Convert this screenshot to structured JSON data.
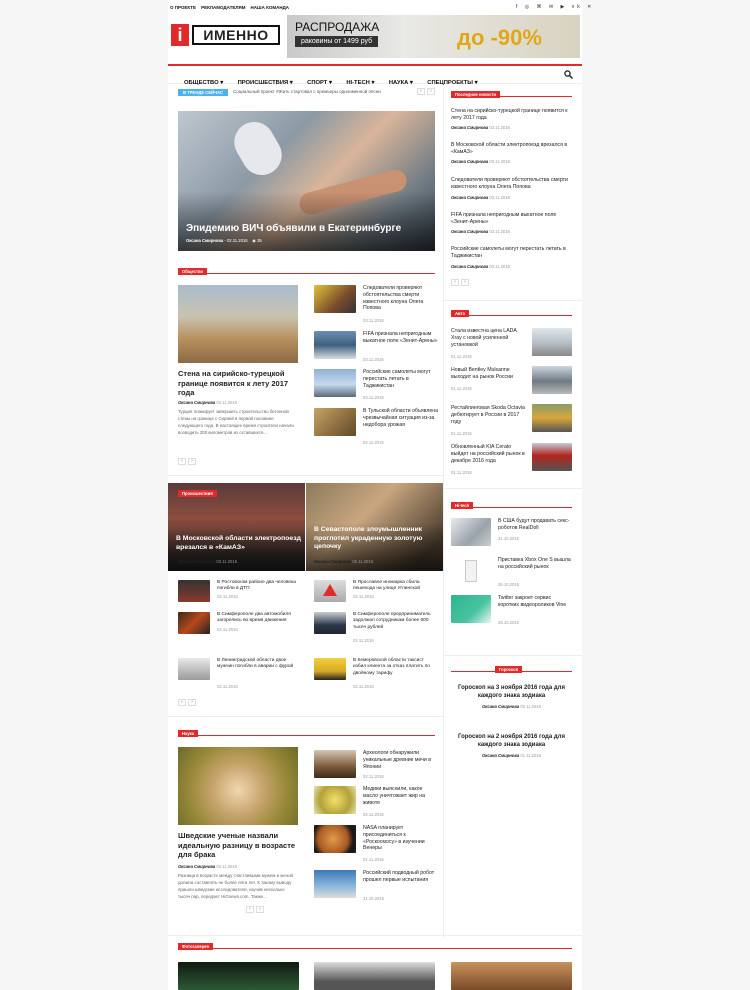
{
  "topbar": {
    "links": [
      "О ПРОЕКТЕ",
      "РЕКЛАМОДАТЕЛЯМ",
      "НАША КОМАНДА"
    ],
    "social": [
      "f",
      "◎",
      "⌘",
      "✉",
      "▶",
      "vk",
      "✕"
    ]
  },
  "logo": {
    "mark": "i",
    "name": "ИМЕННО"
  },
  "banner": {
    "title": "РАСПРОДАЖА",
    "sub": "раковины от 1499 руб",
    "discount": "до -90%"
  },
  "nav": {
    "items": [
      "ОБЩЕСТВО ▾",
      "ПРОИСШЕСТВИЯ ▾",
      "СПОРТ ▾",
      "HI-TECH ▾",
      "НАУКА ▾",
      "СПЕЦПРОЕКТЫ ▾"
    ]
  },
  "trend": {
    "label": "В ТРЕНДЕ СЕЙЧАС",
    "text": "Социальный проект #Жить стартовал с премьеры одноименной песни"
  },
  "hero": {
    "title": "Эпидемию ВИЧ объявили в Екатеринбурге",
    "author": "Оксана Смирнова",
    "date": "02.11.2016",
    "views": "35"
  },
  "society": {
    "badge": "Общество",
    "main": {
      "title": "Стена на сирийско-турецкой границе появится к лету 2017 года",
      "author": "Оксана Смирнова",
      "date": "03.11.2016",
      "excerpt": "Турция планирует завершить строительство бетонной стены на границе с Сирией в первой половине следующего года. В настоящее время строители начали возводить 200 километров из оставшихся..."
    },
    "list": [
      {
        "title": "Следователи проверяют обстоятельства смерти известного клоуна Олега Попова",
        "date": "03.11.2016"
      },
      {
        "title": "FIFA признала непригодным выкатное поле «Зенит-Арены»",
        "date": "03.11.2016"
      },
      {
        "title": "Российские самолеты могут перестать летать в Таджикистан",
        "date": "03.11.2016"
      },
      {
        "title": "В Тульской области объявлена чрезвычайная ситуация из-за недобора урожая",
        "date": "02.11.2016"
      }
    ]
  },
  "incidents": {
    "badge": "Происшествия",
    "big": [
      {
        "title": "В Московской области электропоезд врезался в «КамАЗ»",
        "author": "Оксана Смирнова",
        "date": "03.11.2016"
      },
      {
        "title": "В Севастополе злоумышленник проглотил украденную золотую цепочку",
        "author": "Оксана Смирнова",
        "date": "02.11.2016"
      }
    ],
    "list": [
      {
        "title": "В Ростовском районе два человека погибли в ДТП",
        "date": "02.11.2016"
      },
      {
        "title": "В Ярославле иномарка сбила пешехода на улице Углинской",
        "date": "02.11.2016"
      },
      {
        "title": "В Симферополе два автомобиля загорелись во время движения",
        "date": "02.11.2016"
      },
      {
        "title": "В Симферополе предприниматель задолжал сотрудникам более 600 тысяч рублей",
        "date": "02.11.2016"
      },
      {
        "title": "В Ленинградской области двое мужчин погибли в аварии с фурой",
        "date": "02.11.2016"
      },
      {
        "title": "В Кемеровской области таксист избил клиента за отказ платить по двойному тарифу",
        "date": "02.11.2016"
      }
    ]
  },
  "science": {
    "badge": "Наука",
    "main": {
      "title": "Шведские ученые назвали идеальную разницу в возрасте для брака",
      "author": "Оксана Смирнова",
      "date": "03.11.2016",
      "excerpt": "Разница в возрасте между счастливыми мужем и женой должна составлять не более пяти лет. К такому выводу пришли шведские исследователи, изучив несколько тысяч пар, передает HiGnews.com. Также..."
    },
    "list": [
      {
        "title": "Археологи обнаружили уникальные древние мечи в Японии",
        "date": "02.11.2016"
      },
      {
        "title": "Медики выяснили, какое масло уничтожает жир на животе",
        "date": "02.11.2016"
      },
      {
        "title": "NASA планирует присоединиться к «Роскосмосу» в изучении Венеры",
        "date": "01.11.2016"
      },
      {
        "title": "Российский подводный робот прошел первые испытания",
        "date": "31.10.2016"
      }
    ]
  },
  "photo": {
    "badge": "Фотогалерея"
  },
  "latest": {
    "badge": "Последние новости",
    "items": [
      {
        "title": "Стена на сирийско-турецкой границе появится к лету 2017 года",
        "author": "Оксана Смирнова",
        "date": "03.11.2016"
      },
      {
        "title": "В Московской области электропоезд врезался в «КамАЗ»",
        "author": "Оксана Смирнова",
        "date": "03.11.2016"
      },
      {
        "title": "Следователи проверяют обстоятельства смерти известного клоуна Олега Попова",
        "author": "Оксана Смирнова",
        "date": "03.11.2016"
      },
      {
        "title": "FIFA признала непригодным выкатное поле «Зенит-Арены»",
        "author": "Оксана Смирнова",
        "date": "03.11.2016"
      },
      {
        "title": "Российские самолеты могут перестать летать в Таджикистан",
        "author": "Оксана Смирнова",
        "date": "03.11.2016"
      }
    ]
  },
  "auto": {
    "badge": "Авто",
    "items": [
      {
        "title": "Стала известна цена LADA Xray с новой усиленной установкой",
        "date": "01.11.2016"
      },
      {
        "title": "Новый Bentley Mulsanne выходит на рынок России",
        "date": "01.11.2016"
      },
      {
        "title": "Рестайлинговая Skoda Octavia дебютирует в России в 2017 году",
        "date": "01.11.2016"
      },
      {
        "title": "Обновленный KIA Cerato выйдет на российский рынок в декабре 2016 года",
        "date": "01.11.2016"
      }
    ]
  },
  "hitech": {
    "badge": "Hi-tech",
    "items": [
      {
        "title": "В США будут продавать секс-роботов RealDoll",
        "date": "31.10.2016"
      },
      {
        "title": "Приставка Xbox One S вышла на российский рынок",
        "date": "28.10.2016"
      },
      {
        "title": "Twitter закроет сервис коротких видеороликов Vine",
        "date": "28.10.2016"
      }
    ]
  },
  "horo": {
    "badge": "Гороскоп",
    "items": [
      {
        "title": "Гороскоп на 3 ноября 2016 года для каждого знака зодиака",
        "author": "Оксана Смирнова",
        "date": "03.11.2016"
      },
      {
        "title": "Гороскоп на 2 ноября 2016 года для каждого знака зодиака",
        "author": "Оксана Смирнова",
        "date": "01.11.2016"
      }
    ]
  },
  "colors": {
    "accent": "#e22a2a",
    "trend": "#4db2ec"
  }
}
